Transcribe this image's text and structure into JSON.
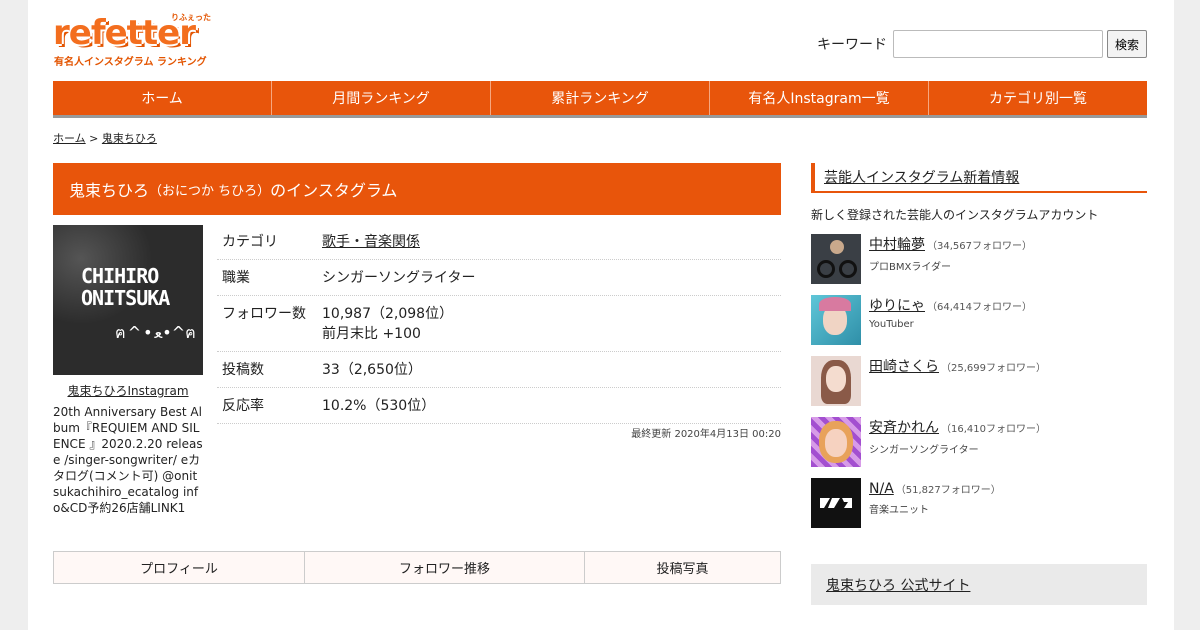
{
  "site": {
    "logo_text": "refetter",
    "logo_ruby": "りふぇったー",
    "logo_sub": "有名人インスタグラム ランキング"
  },
  "search": {
    "label": "キーワード",
    "placeholder": "",
    "button": "検索"
  },
  "nav": [
    "ホーム",
    "月間ランキング",
    "累計ランキング",
    "有名人Instagram一覧",
    "カテゴリ別一覧"
  ],
  "breadcrumb": {
    "home": "ホーム",
    "separator": ">",
    "current": "鬼束ちひろ"
  },
  "profile": {
    "title_name": "鬼束ちひろ",
    "title_kana": "（おにつか ちひろ）",
    "title_suffix": "のインスタグラム",
    "image_text_line1": "CHIHIRO",
    "image_text_line2": "ONITSUKA",
    "image_icons": "ฅ^•ﻌ•^ฅ",
    "image_caption": "鬼束ちひろInstagram",
    "bio": "20th Anniversary Best Album『REQUIEM AND SILENCE 』2020.2.20 release /singer-songwriter/ eカタログ(コメント可) @onitsukachihiro_ecatalog info&CD予約26店舗LINK1",
    "rows": [
      {
        "label": "カテゴリ",
        "value": "歌手・音楽関係",
        "value2": ""
      },
      {
        "label": "職業",
        "value": "シンガーソングライター",
        "value2": ""
      },
      {
        "label": "フォロワー数",
        "value": "10,987（2,098位）",
        "value2": "前月末比 +100"
      },
      {
        "label": "投稿数",
        "value": "33（2,650位）",
        "value2": ""
      },
      {
        "label": "反応率",
        "value": "10.2%（530位）",
        "value2": ""
      }
    ],
    "updated": "最終更新 2020年4月13日 00:20"
  },
  "tabs": [
    "プロフィール",
    "フォロワー推移",
    "投稿写真"
  ],
  "sidebar": {
    "title": "芸能人インスタグラム新着情報",
    "description": "新しく登録された芸能人のインスタグラムアカウント",
    "celebs": [
      {
        "name": "中村輪夢",
        "followers": "（34,567フォロワー）",
        "role": "プロBMXライダー"
      },
      {
        "name": "ゆりにゃ",
        "followers": "（64,414フォロワー）",
        "role": "YouTuber"
      },
      {
        "name": "田崎さくら",
        "followers": "（25,699フォロワー）",
        "role": ""
      },
      {
        "name": "安斉かれん",
        "followers": "（16,410フォロワー）",
        "role": "シンガーソングライター"
      },
      {
        "name": "N/A",
        "followers": "（51,827フォロワー）",
        "role": "音楽ユニット"
      }
    ],
    "official_link": "鬼束ちひろ 公式サイト"
  },
  "colors": {
    "accent": "#e8550b",
    "logo": "#f36e1e"
  }
}
